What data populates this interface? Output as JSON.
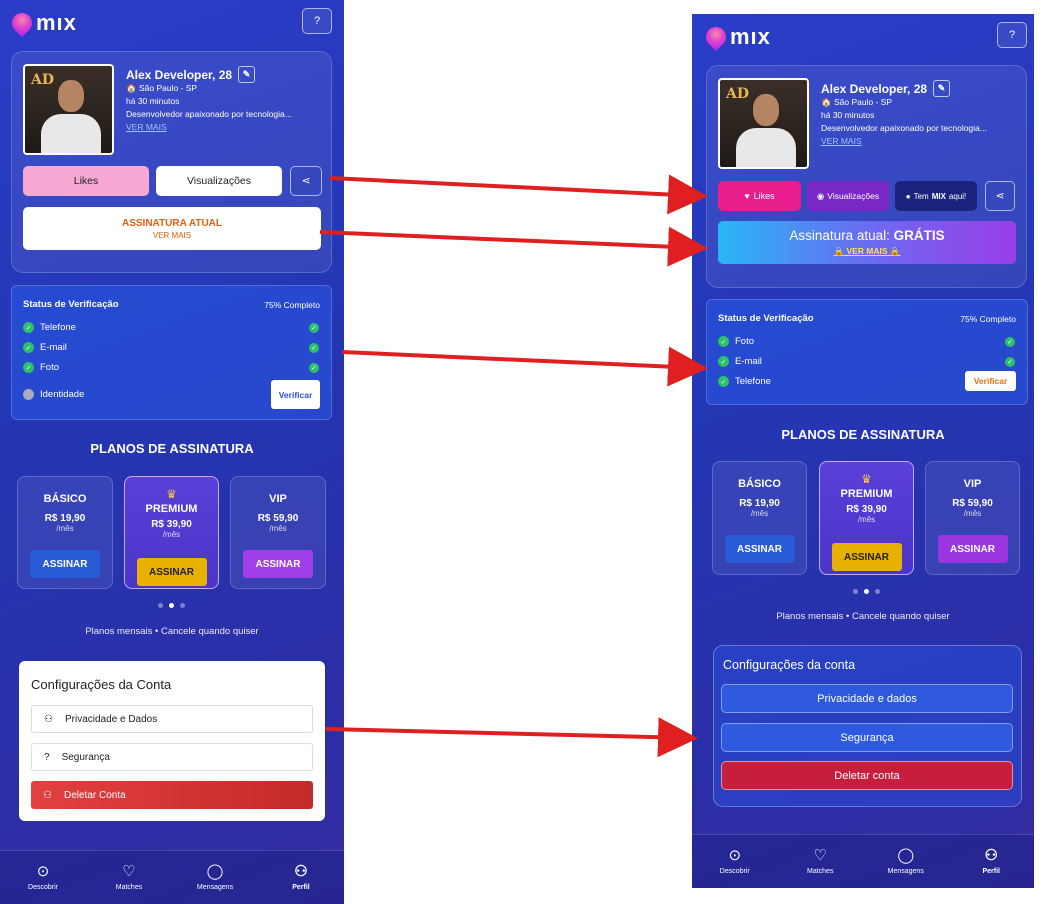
{
  "before": {
    "logo": "mıx",
    "help_icon": "question-icon",
    "profile": {
      "name": "Alex Developer, 28",
      "location": "São Paulo - SP",
      "last_seen": "há 30 minutos",
      "bio": "Desenvolvedor apaixonado por tecnologia...",
      "more": "VER MAIS",
      "photo_logo": "AD"
    },
    "buttons": {
      "likes": "Likes",
      "views": "Visualizações"
    },
    "subscription": {
      "title": "ASSINATURA ATUAL",
      "more": "VER MAIS"
    },
    "verification": {
      "title": "Status de Verificação",
      "percent": "75% Completo",
      "items": [
        "Telefone",
        "E-mail",
        "Foto"
      ],
      "pending": "Identidade",
      "verify_button": "Verificar"
    },
    "plans": {
      "title": "PLANOS DE ASSINATURA",
      "items": [
        {
          "name": "BÁSICO",
          "price": "R$ 19,90",
          "period": "/mês",
          "cta": "ASSINAR",
          "color": "#2a5bd7"
        },
        {
          "name": "PREMIUM",
          "price": "R$ 39,90",
          "period": "/mês",
          "cta": "ASSINAR",
          "color": "#e8b100"
        },
        {
          "name": "VIP",
          "price": "R$ 59,90",
          "period": "/mês",
          "cta": "ASSINAR",
          "color": "#a040e8"
        }
      ],
      "note": "Planos mensais • Cancele quando quiser"
    },
    "settings": {
      "title": "Configurações da Conta",
      "items": [
        "Privacidade e Dados",
        "Segurança",
        "Deletar Conta"
      ]
    },
    "nav": [
      "Descobrir",
      "Matches",
      "Mensagens",
      "Perfil"
    ]
  },
  "after": {
    "logo": "mıx",
    "profile": {
      "name": "Alex Developer, 28",
      "location": "São Paulo - SP",
      "last_seen": "há 30 minutos",
      "bio": "Desenvolvedor apaixonado por tecnologia...",
      "more": "VER MAIS",
      "photo_logo": "AD"
    },
    "buttons": {
      "likes": "Likes",
      "views": "Visualizações",
      "mix_prefix": "Tem ",
      "mix_bold": "MIX",
      "mix_suffix": " aqui!"
    },
    "subscription": {
      "title_prefix": "Assinatura atual: ",
      "title_bold": "GRÁTIS",
      "more": "VER MAIS"
    },
    "verification": {
      "title": "Status de Verificação",
      "percent": "75% Completo",
      "items": [
        "Foto",
        "E-mail",
        "Telefone"
      ],
      "verify_button": "Verificar"
    },
    "plans": {
      "title": "PLANOS DE ASSINATURA",
      "items": [
        {
          "name": "BÁSICO",
          "price": "R$ 19,90",
          "period": "/mês",
          "cta": "ASSINAR",
          "color": "#2a5bd7"
        },
        {
          "name": "PREMIUM",
          "price": "R$ 39,90",
          "period": "/mês",
          "cta": "ASSINAR",
          "color": "#e8b100"
        },
        {
          "name": "VIP",
          "price": "R$ 59,90",
          "period": "/mês",
          "cta": "ASSINAR",
          "color": "#9a35e0"
        }
      ],
      "note": "Planos mensais • Cancele quando quiser"
    },
    "settings": {
      "title": "Configurações da conta",
      "items": [
        "Privacidade e dados",
        "Segurança",
        "Deletar conta"
      ]
    },
    "nav": [
      "Descobrir",
      "Matches",
      "Mensagens",
      "Perfil"
    ]
  },
  "colors": {
    "arrow": "#e02020",
    "likes_before": "#f7a8d3",
    "likes_after": "#e91e8c",
    "views_after": "#7a28c8",
    "mix_btn": "#1a237e"
  }
}
